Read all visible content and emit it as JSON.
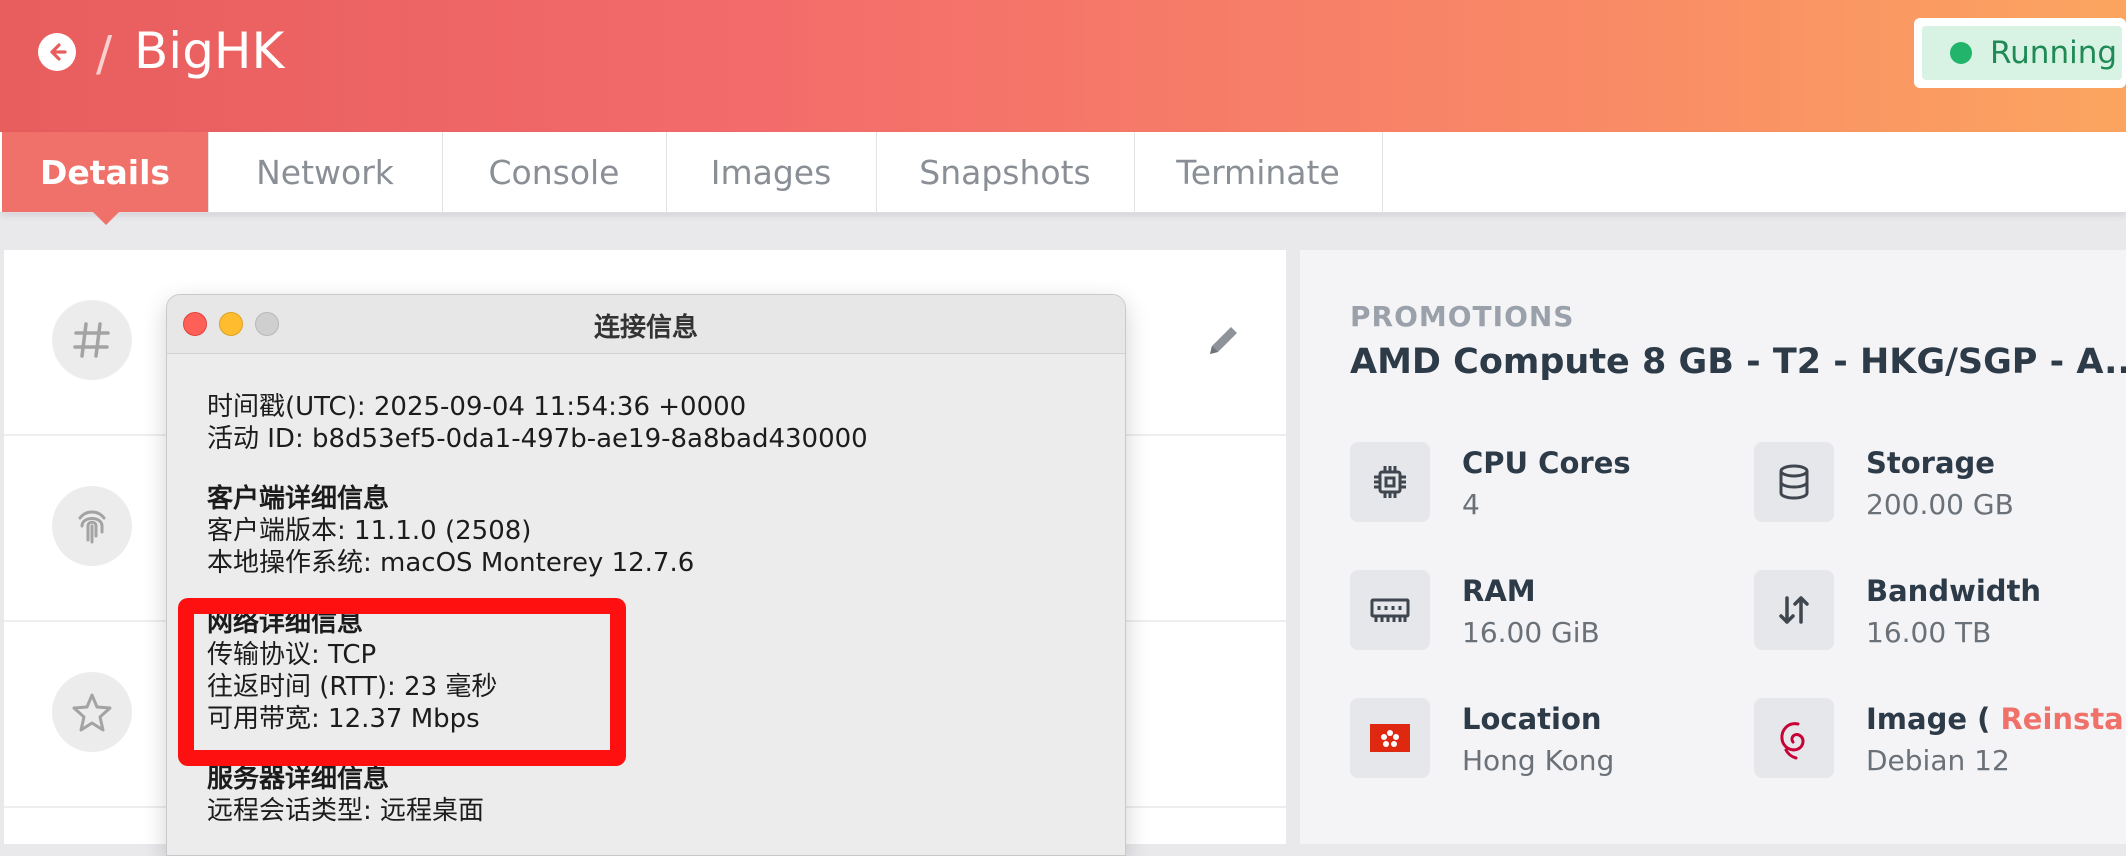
{
  "header": {
    "back_icon": "arrow-left-circle-icon",
    "separator": "/",
    "title": "BigHK",
    "status": "Running",
    "status_color": "#22b46b",
    "brand_gradient": [
      "#e85d5d",
      "#fba560"
    ]
  },
  "tabs": [
    {
      "label": "Details",
      "active": true
    },
    {
      "label": "Network",
      "active": false
    },
    {
      "label": "Console",
      "active": false
    },
    {
      "label": "Images",
      "active": false
    },
    {
      "label": "Snapshots",
      "active": false
    },
    {
      "label": "Terminate",
      "active": false
    }
  ],
  "left_icons": [
    "hash-icon",
    "fingerprint-icon",
    "star-icon",
    "pencil-icon"
  ],
  "promotions": {
    "label": "PROMOTIONS",
    "plan": "AMD Compute 8 GB - T2 - HKG/SGP - A...",
    "specs": [
      {
        "icon": "cpu-icon",
        "label": "CPU Cores",
        "value": "4"
      },
      {
        "icon": "database-icon",
        "label": "Storage",
        "value": "200.00 GB"
      },
      {
        "icon": "memory-icon",
        "label": "RAM",
        "value": "16.00 GiB"
      },
      {
        "icon": "bandwidth-icon",
        "label": "Bandwidth",
        "value": "16.00 TB"
      },
      {
        "icon": "hong-kong-flag-icon",
        "label": "Location",
        "value": "Hong Kong"
      },
      {
        "icon": "debian-icon",
        "label_prefix": "Image (",
        "reinstall": "Reinstall",
        "label_suffix": ")",
        "value": "Debian 12"
      }
    ]
  },
  "modal": {
    "title": "连接信息",
    "timestamp": "时间戳(UTC): 2025-09-04 11:54:36 +0000",
    "activity_id": "活动 ID: b8d53ef5-0da1-497b-ae19-8a8bad430000",
    "client_head": "客户端详细信息",
    "client_version": "客户端版本: 11.1.0 (2508)",
    "client_os": "本地操作系统: macOS Monterey 12.7.6",
    "network_head": "网络详细信息",
    "protocol": "传输协议: TCP",
    "rtt": "往返时间 (RTT): 23 毫秒",
    "bandwidth": "可用带宽: 12.37 Mbps",
    "server_head": "服务器详细信息",
    "session_type": "远程会话类型: 远程桌面"
  },
  "highlight_color": "#ff1010"
}
